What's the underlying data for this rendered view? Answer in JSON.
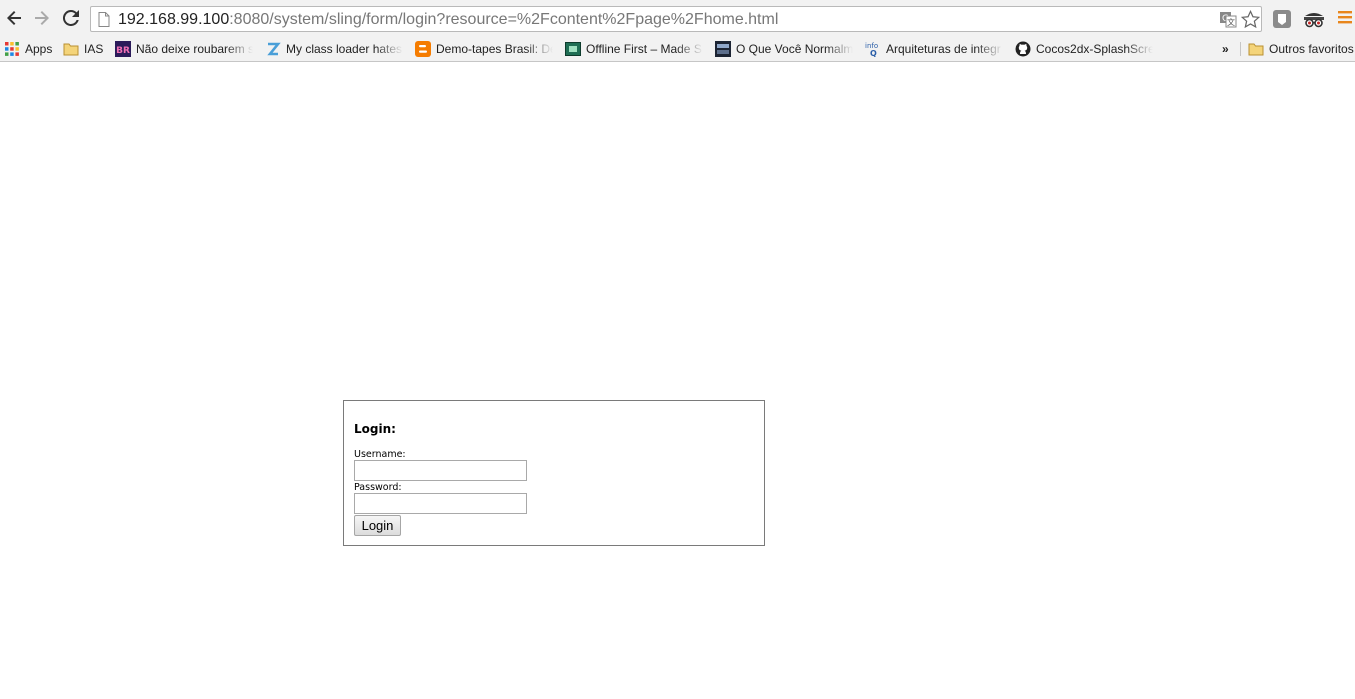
{
  "browser": {
    "url_host": "192.168.99.100",
    "url_rest": ":8080/system/sling/form/login?resource=%2Fcontent%2Fpage%2Fhome.html",
    "bookmarks": [
      {
        "label": "Apps",
        "icon": "apps-grid-icon"
      },
      {
        "label": "IAS",
        "icon": "folder-icon"
      },
      {
        "label": "Não deixe roubarem s",
        "icon": "br-site-icon"
      },
      {
        "label": "My class loader hates",
        "icon": "z-site-icon"
      },
      {
        "label": "Demo-tapes Brasil: De",
        "icon": "blogger-icon"
      },
      {
        "label": "Offline First – Made Si",
        "icon": "offline-first-icon"
      },
      {
        "label": "O Que Você Normalm",
        "icon": "avatar-site-icon"
      },
      {
        "label": "Arquiteturas de integr",
        "icon": "infoq-icon"
      },
      {
        "label": "Cocos2dx-SplashScree",
        "icon": "github-icon"
      }
    ],
    "overflow_label": "»",
    "other_bookmarks_label": "Outros favoritos"
  },
  "login_form": {
    "title": "Login:",
    "username_label": "Username:",
    "username_value": "",
    "password_label": "Password:",
    "password_value": "",
    "submit_label": "Login"
  },
  "colors": {
    "toolbar_bg": "#f2f2f2",
    "form_border": "#7a7a7a",
    "menu_orange": "#e8861c"
  }
}
